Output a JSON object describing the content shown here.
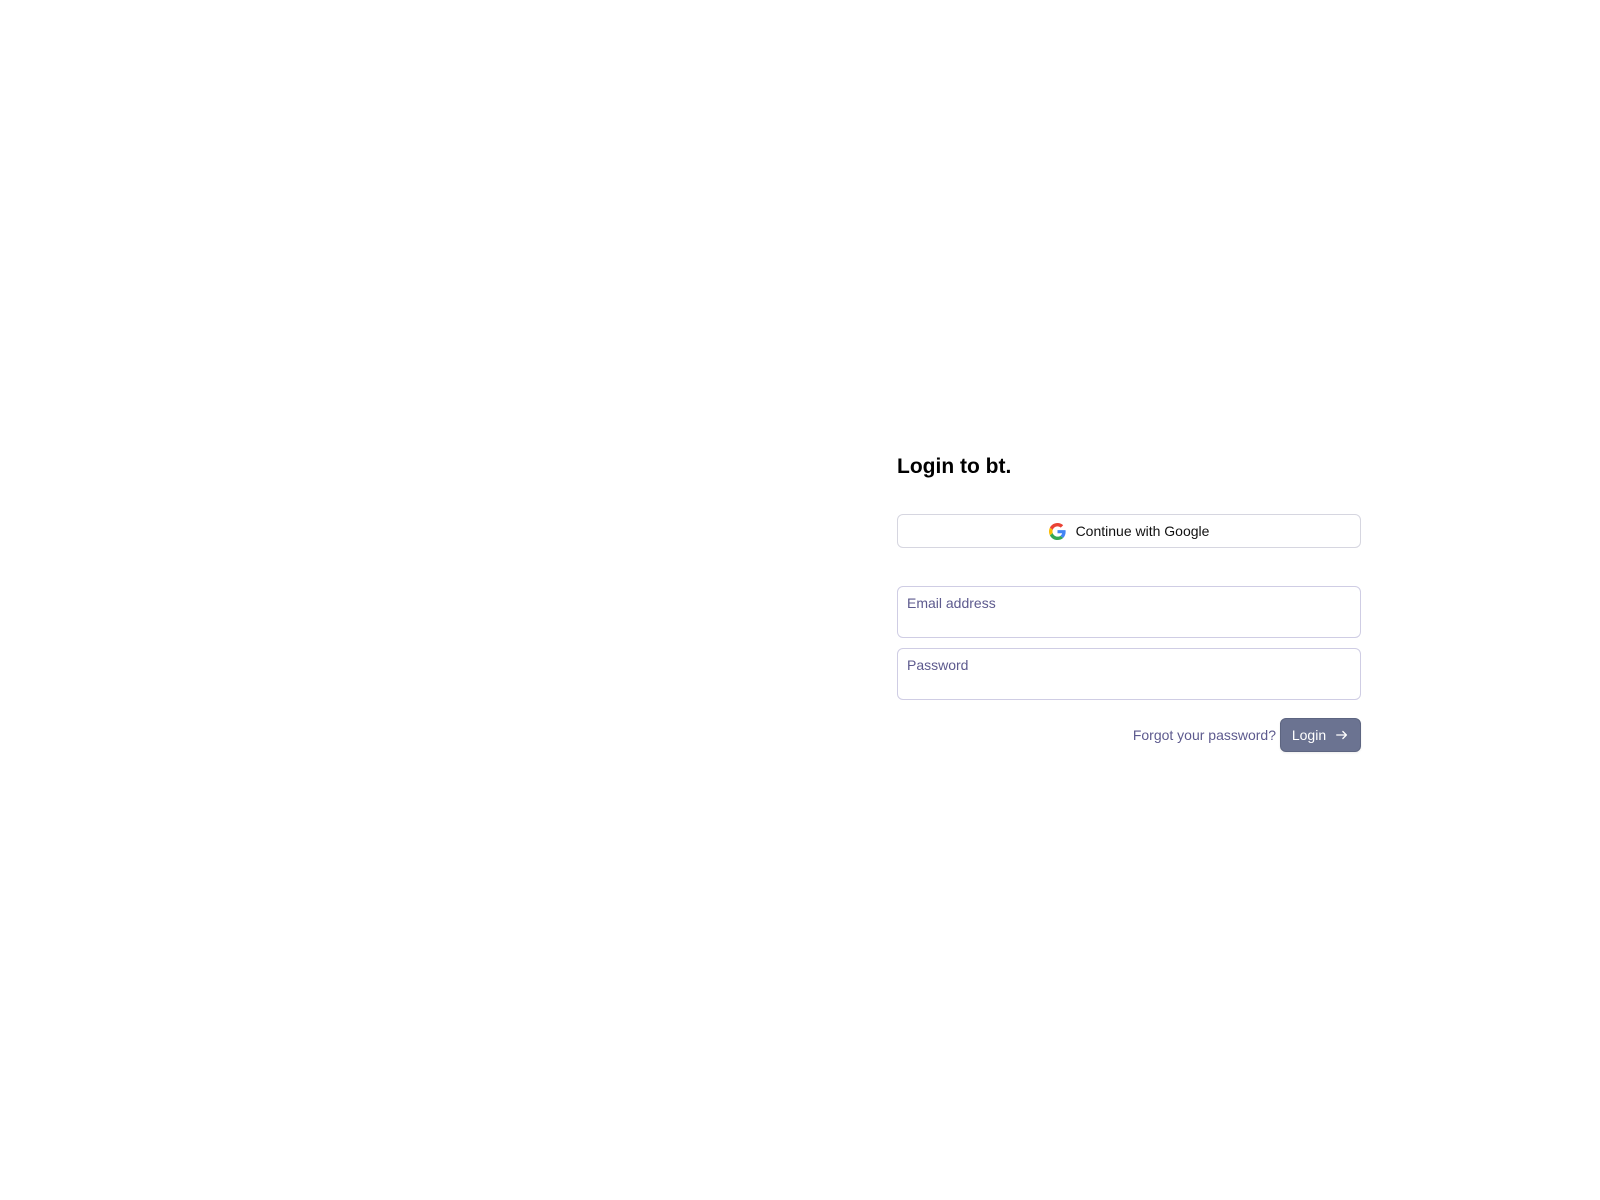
{
  "login": {
    "title": "Login to bt.",
    "google_button_label": "Continue with Google",
    "email_label": "Email address",
    "password_label": "Password",
    "forgot_password_label": "Forgot your password?",
    "login_button_label": "Login"
  },
  "icons": {
    "google": "google-icon",
    "login_arrow": "arrow-right-icon"
  },
  "colors": {
    "label_text": "#5d5a8e",
    "login_button_bg": "#6b7391",
    "field_border": "#cfcde4"
  }
}
